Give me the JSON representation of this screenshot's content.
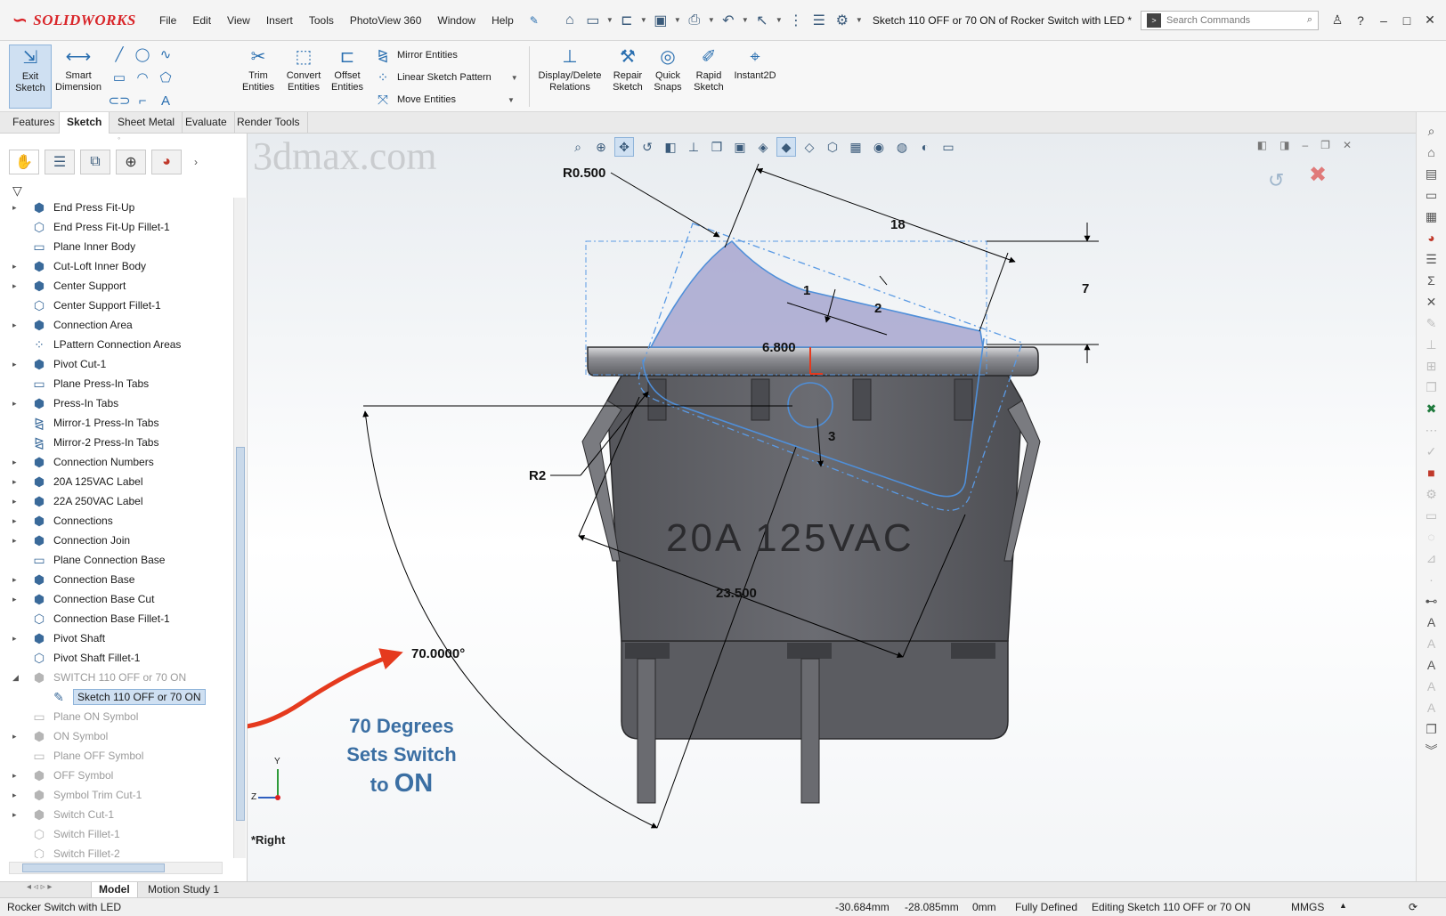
{
  "app": {
    "logo_text": "SOLIDWORKS",
    "watermark": "3dmax.com",
    "menus": [
      "File",
      "Edit",
      "View",
      "Insert",
      "Tools",
      "PhotoView 360",
      "Window",
      "Help"
    ],
    "document_title": "Sketch 110 OFF or 70 ON of Rocker Switch with LED *",
    "search_placeholder": "Search Commands"
  },
  "command_manager": {
    "exit_sketch": "Exit Sketch",
    "smart_dimension": "Smart Dimension",
    "trim_entities": "Trim Entities",
    "convert_entities": "Convert Entities",
    "offset_entities": "Offset Entities",
    "mirror_entities": "Mirror Entities",
    "linear_sketch_pattern": "Linear Sketch Pattern",
    "move_entities": "Move Entities",
    "display_delete_relations": "Display/Delete Relations",
    "repair_sketch": "Repair Sketch",
    "quick_snaps": "Quick Snaps",
    "rapid_sketch": "Rapid Sketch",
    "instant2d": "Instant2D"
  },
  "tabs": [
    "Features",
    "Sketch",
    "Sheet Metal",
    "Evaluate",
    "Render Tools"
  ],
  "active_tab": "Sketch",
  "feature_tree": {
    "items": [
      {
        "label": "End Press Fit-Up",
        "expandable": true
      },
      {
        "label": "End Press Fit-Up Fillet-1",
        "expandable": false
      },
      {
        "label": "Plane Inner Body",
        "expandable": false
      },
      {
        "label": "Cut-Loft Inner Body",
        "expandable": true
      },
      {
        "label": "Center Support",
        "expandable": true
      },
      {
        "label": "Center Support Fillet-1",
        "expandable": false
      },
      {
        "label": "Connection Area",
        "expandable": true
      },
      {
        "label": "LPattern Connection Areas",
        "expandable": false
      },
      {
        "label": "Pivot Cut-1",
        "expandable": true
      },
      {
        "label": "Plane Press-In Tabs",
        "expandable": false
      },
      {
        "label": "Press-In Tabs",
        "expandable": true
      },
      {
        "label": "Mirror-1 Press-In Tabs",
        "expandable": false
      },
      {
        "label": "Mirror-2 Press-In Tabs",
        "expandable": false
      },
      {
        "label": "Connection Numbers",
        "expandable": true
      },
      {
        "label": "20A  125VAC Label",
        "expandable": true
      },
      {
        "label": "22A  250VAC Label",
        "expandable": true
      },
      {
        "label": "Connections",
        "expandable": true
      },
      {
        "label": "Connection Join",
        "expandable": true
      },
      {
        "label": "Plane Connection Base",
        "expandable": false
      },
      {
        "label": "Connection Base",
        "expandable": true
      },
      {
        "label": "Connection Base Cut",
        "expandable": true
      },
      {
        "label": "Connection Base Fillet-1",
        "expandable": false
      },
      {
        "label": "Pivot Shaft",
        "expandable": true
      },
      {
        "label": "Pivot Shaft Fillet-1",
        "expandable": false
      },
      {
        "label": "SWITCH 110 OFF or 70 ON",
        "expandable": true,
        "dim": true,
        "expanded": true
      },
      {
        "label": "Sketch 110 OFF or 70 ON",
        "child": true,
        "selected": true
      },
      {
        "label": "Plane ON Symbol",
        "expandable": false,
        "dim": true
      },
      {
        "label": "ON Symbol",
        "expandable": true,
        "dim": true
      },
      {
        "label": "Plane OFF Symbol",
        "expandable": false,
        "dim": true
      },
      {
        "label": "OFF Symbol",
        "expandable": true,
        "dim": true
      },
      {
        "label": "Symbol Trim Cut-1",
        "expandable": true,
        "dim": true
      },
      {
        "label": "Switch Cut-1",
        "expandable": true,
        "dim": true
      },
      {
        "label": "Switch Fillet-1",
        "expandable": false,
        "dim": true
      },
      {
        "label": "Switch Fillet-2",
        "expandable": false,
        "dim": true
      }
    ]
  },
  "viewport": {
    "view_name": "*Right",
    "part_label": "20A  125VAC",
    "callout_line1": "70 Degrees",
    "callout_line2": "Sets Switch",
    "callout_line3": "to",
    "callout_on": "ON",
    "dimensions": {
      "r0500": "R0.500",
      "d18": "18",
      "d1": "1",
      "d2": "2",
      "d7": "7",
      "d6800": "6.800",
      "d3": "3",
      "r2": "R2",
      "d23500": "23.500",
      "angle": "70.0000°"
    },
    "triad_y": "Y",
    "triad_z": "Z"
  },
  "model_tabs": [
    "Model",
    "Motion Study 1"
  ],
  "status": {
    "part_name": "Rocker Switch with LED",
    "x": "-30.684mm",
    "y": "-28.085mm",
    "z": "0mm",
    "state": "Fully Defined",
    "editing": "Editing Sketch 110 OFF or 70 ON",
    "units": "MMGS"
  }
}
